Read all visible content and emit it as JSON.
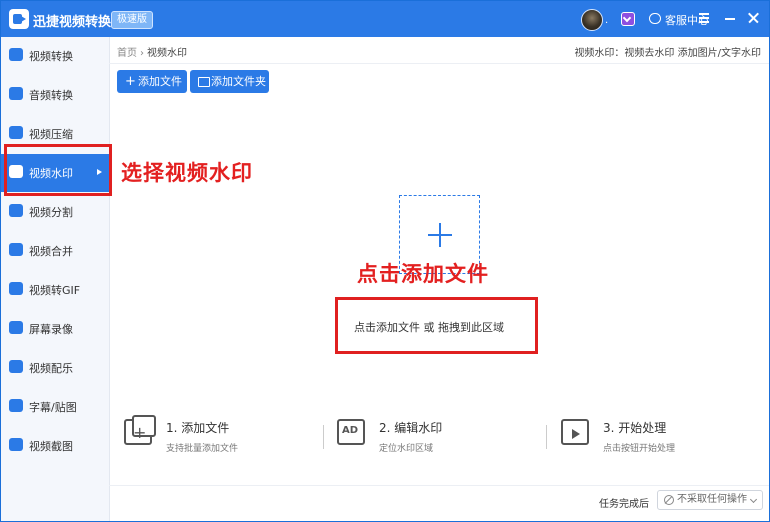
{
  "app": {
    "title": "迅捷视频转换器",
    "badge": "极速版",
    "service": "客服中心",
    "avatar_suffix": "."
  },
  "colors": {
    "accent": "#2b7ae6",
    "annotation": "#e02020"
  },
  "sidebar": {
    "items": [
      {
        "label": "视频转换",
        "icon": "video-convert-icon"
      },
      {
        "label": "音频转换",
        "icon": "audio-convert-icon"
      },
      {
        "label": "视频压缩",
        "icon": "video-compress-icon"
      },
      {
        "label": "视频水印",
        "icon": "video-watermark-icon",
        "active": true
      },
      {
        "label": "视频分割",
        "icon": "video-split-icon"
      },
      {
        "label": "视频合并",
        "icon": "video-merge-icon"
      },
      {
        "label": "视频转GIF",
        "icon": "gif-icon"
      },
      {
        "label": "屏幕录像",
        "icon": "screen-record-icon"
      },
      {
        "label": "视频配乐",
        "icon": "music-icon"
      },
      {
        "label": "字幕/贴图",
        "icon": "subtitle-icon"
      },
      {
        "label": "视频截图",
        "icon": "screenshot-icon"
      }
    ]
  },
  "breadcrumb": {
    "home": "首页",
    "sep": "›",
    "current": "视频水印"
  },
  "description": "视频水印：视频去水印 添加图片/文字水印",
  "toolbar": {
    "add_file": "添加文件",
    "add_folder": "添加文件夹",
    "add_file_icon": "+"
  },
  "drop": {
    "hint": "点击添加文件 或 拖拽到此区域"
  },
  "annotations": {
    "select": "选择视频水印",
    "click_add": "点击添加文件"
  },
  "steps": [
    {
      "title": "1. 添加文件",
      "sub": "支持批量添加文件",
      "icon": "add-files-icon"
    },
    {
      "title": "2. 编辑水印",
      "sub": "定位水印区域",
      "icon": "ad-watermark-icon",
      "icon_text": "AD"
    },
    {
      "title": "3. 开始处理",
      "sub": "点击按钮开始处理",
      "icon": "clapper-icon"
    }
  ],
  "footer": {
    "label": "任务完成后",
    "select_value": "不采取任何操作"
  }
}
